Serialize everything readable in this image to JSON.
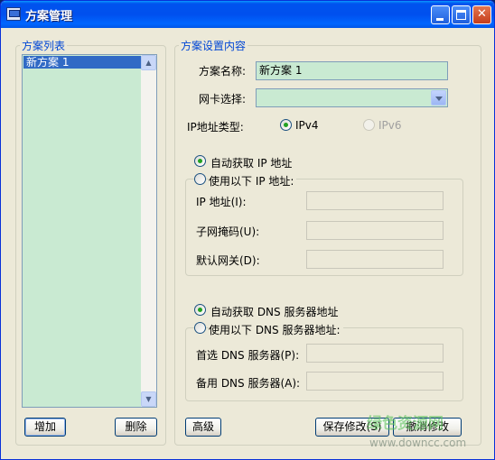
{
  "window": {
    "title": "方案管理"
  },
  "left_panel": {
    "legend": "方案列表",
    "items": [
      "新方案 1"
    ],
    "add_button": "增加",
    "delete_button": "删除"
  },
  "right_panel": {
    "legend": "方案设置内容",
    "scheme_name_label": "方案名称:",
    "scheme_name_value": "新方案 1",
    "nic_label": "网卡选择:",
    "nic_value": "",
    "ip_type_label": "IP地址类型:",
    "ipv4_label": "IPv4",
    "ipv6_label": "IPv6",
    "ip_auto_label": "自动获取 IP 地址",
    "ip_manual_label": "使用以下 IP 地址:",
    "ip_address_label": "IP  地址(I):",
    "subnet_label": "子网掩码(U):",
    "gateway_label": "默认网关(D):",
    "dns_auto_label": "自动获取 DNS 服务器地址",
    "dns_manual_label": "使用以下 DNS 服务器地址:",
    "dns_primary_label": "首选 DNS 服务器(P):",
    "dns_secondary_label": "备用 DNS 服务器(A):",
    "advanced_button": "高级",
    "save_button": "保存修改(S)",
    "cancel_button": "撤消修改"
  },
  "watermark": {
    "text": "绿色资源网",
    "url": "www.downcc.com"
  }
}
